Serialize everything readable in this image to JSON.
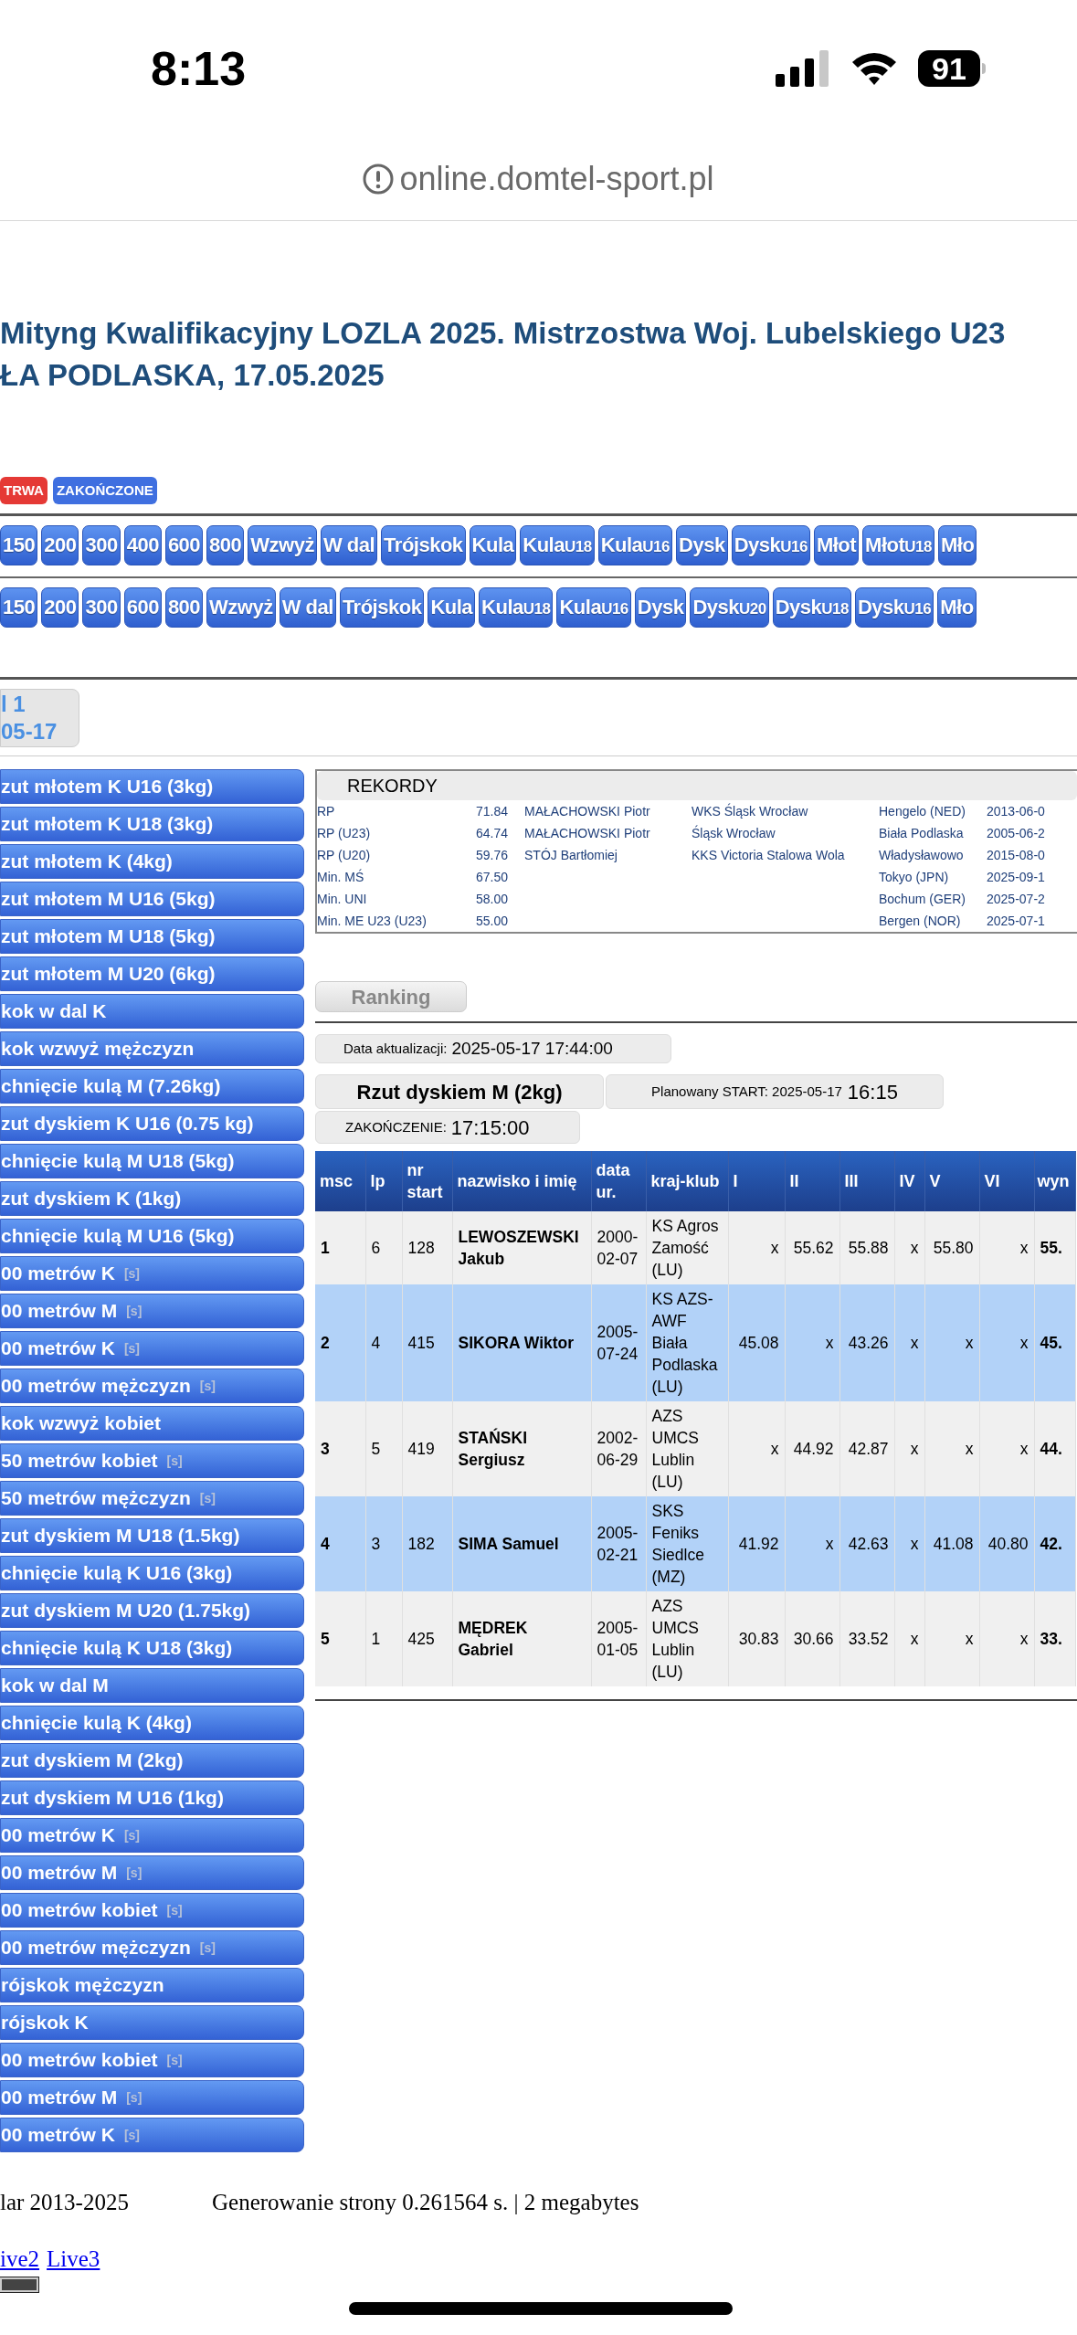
{
  "status_bar": {
    "time": "8:13",
    "battery": "91"
  },
  "address_bar": {
    "url": "online.domtel-sport.pl"
  },
  "title_lines": [
    "Mityng Kwalifikacyjny LOZLA 2025. Mistrzostwa Woj. Lubelskiego U23",
    "ŁA PODLASKA, 17.05.2025"
  ],
  "legend": [
    {
      "label": "TRWA",
      "color": "#e53935"
    },
    {
      "label": "ZAKOŃCZONE",
      "color": "#3f6fe0"
    }
  ],
  "event_rows": [
    [
      {
        "label": "150"
      },
      {
        "label": "200"
      },
      {
        "label": "300"
      },
      {
        "label": "400"
      },
      {
        "label": "600"
      },
      {
        "label": "800"
      },
      {
        "label": "Wzwyż"
      },
      {
        "label": "W dal"
      },
      {
        "label": "Trójskok"
      },
      {
        "label": "Kula"
      },
      {
        "label": "Kula",
        "sub": "U18"
      },
      {
        "label": "Kula",
        "sub": "U16"
      },
      {
        "label": "Dysk"
      },
      {
        "label": "Dysk",
        "sub": "U16"
      },
      {
        "label": "Młot"
      },
      {
        "label": "Młot",
        "sub": "U18"
      },
      {
        "label": "Mło"
      }
    ],
    [
      {
        "label": "150"
      },
      {
        "label": "200"
      },
      {
        "label": "300"
      },
      {
        "label": "600"
      },
      {
        "label": "800"
      },
      {
        "label": "Wzwyż"
      },
      {
        "label": "W dal"
      },
      {
        "label": "Trójskok"
      },
      {
        "label": "Kula"
      },
      {
        "label": "Kula",
        "sub": "U18"
      },
      {
        "label": "Kula",
        "sub": "U16"
      },
      {
        "label": "Dysk"
      },
      {
        "label": "Dysk",
        "sub": "U20"
      },
      {
        "label": "Dysk",
        "sub": "U18"
      },
      {
        "label": "Dysk",
        "sub": "U16"
      },
      {
        "label": "Mło"
      }
    ]
  ],
  "day_tab": {
    "lines": [
      "l 1",
      "05-17"
    ]
  },
  "sidebar": {
    "items": [
      {
        "label": "zut młotem K U16 (3kg)"
      },
      {
        "label": "zut młotem K U18 (3kg)"
      },
      {
        "label": "zut młotem K (4kg)"
      },
      {
        "label": "zut młotem M U16 (5kg)"
      },
      {
        "label": "zut młotem M U18 (5kg)"
      },
      {
        "label": "zut młotem M U20 (6kg)"
      },
      {
        "label": "kok w dal K"
      },
      {
        "label": "kok wzwyż mężczyzn"
      },
      {
        "label": "chnięcie kulą M (7.26kg)"
      },
      {
        "label": "zut dyskiem K U16 (0.75 kg)"
      },
      {
        "label": "chnięcie kulą M U18 (5kg)"
      },
      {
        "label": "zut dyskiem K (1kg)"
      },
      {
        "label": "chnięcie kulą M U16 (5kg)"
      },
      {
        "label": "00 metrów K",
        "suffix": "[s]"
      },
      {
        "label": "00 metrów M",
        "suffix": "[s]"
      },
      {
        "label": "00 metrów K",
        "suffix": "[s]"
      },
      {
        "label": "00 metrów mężczyzn",
        "suffix": "[s]"
      },
      {
        "label": "kok wzwyż kobiet"
      },
      {
        "label": "50 metrów kobiet",
        "suffix": "[s]"
      },
      {
        "label": "50 metrów mężczyzn",
        "suffix": "[s]"
      },
      {
        "label": "zut dyskiem M U18 (1.5kg)"
      },
      {
        "label": "chnięcie kulą K U16 (3kg)"
      },
      {
        "label": "zut dyskiem M U20 (1.75kg)"
      },
      {
        "label": "chnięcie kulą K U18 (3kg)"
      },
      {
        "label": "kok w dal M"
      },
      {
        "label": "chnięcie kulą K (4kg)"
      },
      {
        "label": "zut dyskiem M (2kg)"
      },
      {
        "label": "zut dyskiem M U16 (1kg)"
      },
      {
        "label": "00 metrów K",
        "suffix": "[s]"
      },
      {
        "label": "00 metrów M",
        "suffix": "[s]"
      },
      {
        "label": "00 metrów kobiet",
        "suffix": "[s]"
      },
      {
        "label": "00 metrów mężczyzn",
        "suffix": "[s]"
      },
      {
        "label": "rójskok mężczyzn"
      },
      {
        "label": "rójskok K"
      },
      {
        "label": "00 metrów kobiet",
        "suffix": "[s]"
      },
      {
        "label": "00 metrów M",
        "suffix": "[s]"
      },
      {
        "label": "00 metrów K",
        "suffix": "[s]"
      }
    ]
  },
  "records": {
    "title": "REKORDY",
    "rows": [
      {
        "label": "RP",
        "value": "71.84",
        "name": "MAŁACHOWSKI Piotr",
        "club": "WKS Śląsk Wrocław",
        "place": "Hengelo (NED)",
        "date": "2013-06-0"
      },
      {
        "label": "RP (U23)",
        "value": "64.74",
        "name": "MAŁACHOWSKI Piotr",
        "club": "Śląsk Wrocław",
        "place": "Biała Podlaska",
        "date": "2005-06-2"
      },
      {
        "label": "RP (U20)",
        "value": "59.76",
        "name": "STÓJ Bartłomiej",
        "club": "KKS Victoria Stalowa Wola",
        "place": "Władysławowo",
        "date": "2015-08-0"
      },
      {
        "label": "Min. MŚ",
        "value": "67.50",
        "place": "Tokyo (JPN)",
        "date": "2025-09-1"
      },
      {
        "label": "Min. UNI",
        "value": "58.00",
        "place": "Bochum (GER)",
        "date": "2025-07-2"
      },
      {
        "label": "Min. ME U23 (U23)",
        "value": "55.00",
        "place": "Bergen (NOR)",
        "date": "2025-07-1"
      }
    ]
  },
  "ranking_button": "Ranking",
  "update": {
    "label": "Data aktualizacji:",
    "value": "2025-05-17 17:44:00"
  },
  "event": {
    "name": "Rzut dyskiem M (2kg)",
    "start_label": "Planowany START: 2025-05-17",
    "start_time": "16:15",
    "end_label": "ZAKOŃCZENIE:",
    "end_time": "17:15:00"
  },
  "results": {
    "columns": [
      "msc",
      "lp",
      "nr start",
      "nazwisko i imię",
      "data ur.",
      "kraj-klub",
      "I",
      "II",
      "III",
      "IV",
      "V",
      "VI",
      "wyn"
    ],
    "rows": [
      [
        "1",
        "6",
        "128",
        "LEWOSZEWSKI Jakub",
        "2000-02-07",
        "KS Agros Zamość (LU)",
        "x",
        "55.62",
        "55.88",
        "x",
        "55.80",
        "x",
        "55."
      ],
      [
        "2",
        "4",
        "415",
        "SIKORA Wiktor",
        "2005-07-24",
        "KS AZS-AWF Biała Podlaska (LU)",
        "45.08",
        "x",
        "43.26",
        "x",
        "x",
        "x",
        "45."
      ],
      [
        "3",
        "5",
        "419",
        "STAŃSKI Sergiusz",
        "2002-06-29",
        "AZS UMCS Lublin (LU)",
        "x",
        "44.92",
        "42.87",
        "x",
        "x",
        "x",
        "44."
      ],
      [
        "4",
        "3",
        "182",
        "SIMA Samuel",
        "2005-02-21",
        "SKS Feniks Siedlce (MZ)",
        "41.92",
        "x",
        "42.63",
        "x",
        "41.08",
        "40.80",
        "42."
      ],
      [
        "5",
        "1",
        "425",
        "MĘDREK Gabriel",
        "2005-01-05",
        "AZS UMCS Lublin (LU)",
        "30.83",
        "30.66",
        "33.52",
        "x",
        "x",
        "x",
        "33."
      ]
    ]
  },
  "footer": {
    "copyright": "lar 2013-2025",
    "generation": "Generowanie strony 0.261564 s. | 2 megabytes",
    "links": [
      "ive2",
      "Live3"
    ]
  }
}
